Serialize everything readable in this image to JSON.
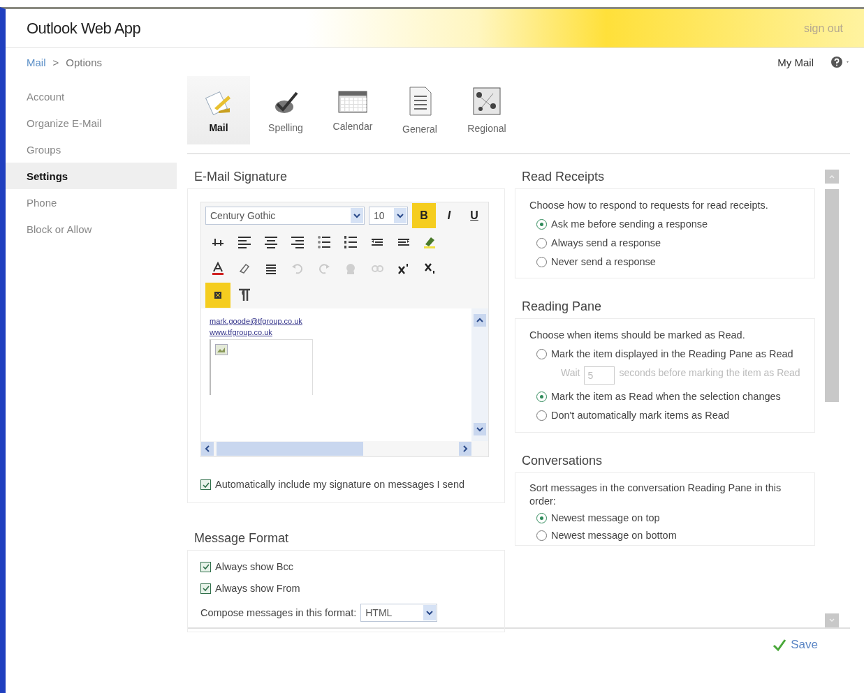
{
  "header": {
    "logo": "Outlook Web App",
    "sign_out": "sign out"
  },
  "breadcrumb": {
    "items": [
      "Mail",
      "Options"
    ],
    "separator": ">"
  },
  "top_right": {
    "my_mail": "My Mail"
  },
  "sidebar": {
    "items": [
      {
        "label": "Account",
        "selected": false
      },
      {
        "label": "Organize E-Mail",
        "selected": false
      },
      {
        "label": "Groups",
        "selected": false
      },
      {
        "label": "Settings",
        "selected": true
      },
      {
        "label": "Phone",
        "selected": false
      },
      {
        "label": "Block or Allow",
        "selected": false
      }
    ]
  },
  "tabs": [
    {
      "label": "Mail",
      "kind": "mail",
      "selected": true
    },
    {
      "label": "Spelling",
      "kind": "spelling",
      "selected": false
    },
    {
      "label": "Calendar",
      "kind": "calendar",
      "selected": false
    },
    {
      "label": "General",
      "kind": "general",
      "selected": false
    },
    {
      "label": "Regional",
      "kind": "regional",
      "selected": false
    }
  ],
  "signature": {
    "title": "E-Mail Signature",
    "font": "Century Gothic",
    "size": "10",
    "format_buttons": [
      {
        "label": "B",
        "selected": true
      },
      {
        "label": "I",
        "selected": false
      },
      {
        "label": "U",
        "selected": false
      }
    ],
    "toolbar_rows": [
      [
        {
          "kind": "highlight-line",
          "disabled": false
        },
        {
          "kind": "align-left",
          "disabled": false
        },
        {
          "kind": "align-center",
          "disabled": false
        },
        {
          "kind": "align-right",
          "disabled": false
        },
        {
          "kind": "bullets",
          "disabled": false
        },
        {
          "kind": "numbering",
          "disabled": false
        },
        {
          "kind": "outdent",
          "disabled": false
        },
        {
          "kind": "indent",
          "disabled": false
        },
        {
          "kind": "highlighter",
          "disabled": false
        }
      ],
      [
        {
          "kind": "font-color",
          "disabled": false
        },
        {
          "kind": "eraser",
          "disabled": false
        },
        {
          "kind": "rule",
          "disabled": false
        },
        {
          "kind": "undo",
          "disabled": true
        },
        {
          "kind": "redo",
          "disabled": true
        },
        {
          "kind": "link",
          "disabled": true
        },
        {
          "kind": "unlink",
          "disabled": true
        },
        {
          "kind": "superscript",
          "disabled": false
        },
        {
          "kind": "subscript",
          "disabled": false
        }
      ]
    ],
    "direction_buttons": [
      {
        "kind": "ltr",
        "selected": true
      },
      {
        "kind": "rtl",
        "selected": false
      }
    ],
    "body_links": [
      "mark.goode@tfgroup.co.uk",
      "www.tfgroup.co.uk"
    ],
    "auto_include": {
      "label": "Automatically include my signature on messages I send",
      "checked": true
    }
  },
  "message_format": {
    "title": "Message Format",
    "checkboxes": [
      {
        "label": "Always show Bcc",
        "checked": true
      },
      {
        "label": "Always show From",
        "checked": true
      }
    ],
    "compose_label": "Compose messages in this format:",
    "compose_value": "HTML"
  },
  "read_receipts": {
    "title": "Read Receipts",
    "prompt": "Choose how to respond to requests for read receipts.",
    "options": [
      {
        "label": "Ask me before sending a response",
        "selected": true
      },
      {
        "label": "Always send a response",
        "selected": false
      },
      {
        "label": "Never send a response",
        "selected": false
      }
    ]
  },
  "reading_pane": {
    "title": "Reading Pane",
    "prompt": "Choose when items should be marked as Read.",
    "options": [
      {
        "label": "Mark the item displayed in the Reading Pane as Read",
        "selected": false
      },
      {
        "label": "Mark the item as Read when the selection changes",
        "selected": true
      },
      {
        "label": "Don't automatically mark items as Read",
        "selected": false
      }
    ],
    "wait": {
      "before": "Wait",
      "value": "5",
      "after": "seconds before marking the item as Read",
      "disabled": true
    }
  },
  "conversations": {
    "title": "Conversations",
    "prompt": "Sort messages in the conversation Reading Pane in this order:",
    "options": [
      {
        "label": "Newest message on top",
        "selected": true
      },
      {
        "label": "Newest message on bottom",
        "selected": false
      }
    ]
  },
  "save": "Save"
}
